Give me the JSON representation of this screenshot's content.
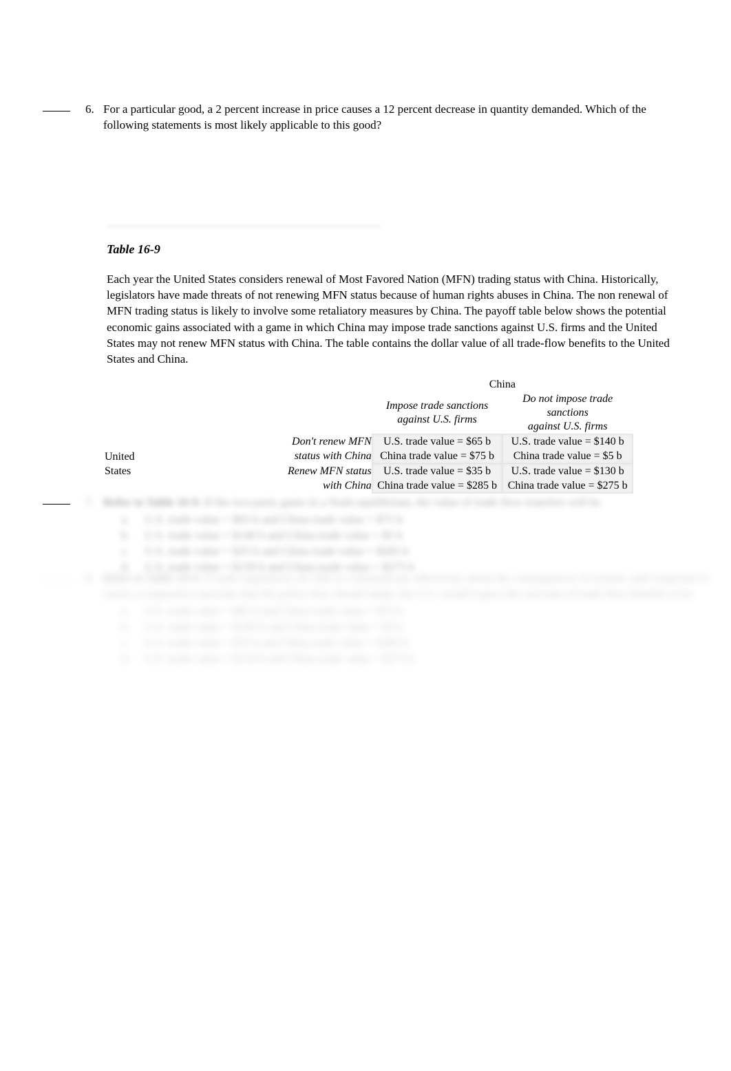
{
  "questions": {
    "q6": {
      "number": "6.",
      "text": "For a particular good, a 2 percent increase in price causes a 12 percent decrease in quantity demanded. Which of the following statements is most likely applicable to this good?"
    },
    "q7": {
      "number": "7.",
      "lead_in": "Refer to Table 16-9.",
      "text": "If the two-party game in a Nash equilibrium, the value of trade flow transfers will be",
      "options": [
        {
          "letter": "a.",
          "text": "U.S. trade value = $65 b and China trade value = $75 b"
        },
        {
          "letter": "b.",
          "text": "U.S. trade value = $140 b and China trade value = $5 b"
        },
        {
          "letter": "c.",
          "text": "U.S. trade value = $35 b and China trade value = $285 b"
        },
        {
          "letter": "d.",
          "text": "U.S. trade value = $130 b and China trade value = $275 b"
        }
      ]
    },
    "q8": {
      "number": "8.",
      "lead_in": "Refer to Table 16-9.",
      "text": "If trade negotiators are able to communicate effectively about the consequences of actions, and cooperate to reach a cooperative outcome that the policy they should adopt, the U.S. would expect the outcome of trade flow benefits to be",
      "options": [
        {
          "letter": "a.",
          "text": "U.S. trade value = $65 b and China trade value = $75 b"
        },
        {
          "letter": "b.",
          "text": "U.S. trade value = $140 b and China trade value = $5 b"
        },
        {
          "letter": "c.",
          "text": "U.S. trade value = $35 b and China trade value = $285 b"
        },
        {
          "letter": "d.",
          "text": "U.S. trade value = $130 b and China trade value = $275 b"
        }
      ]
    }
  },
  "table_16_9": {
    "title": "Table 16-9",
    "description": "Each year the United States considers renewal of Most Favored Nation (MFN) trading status with China. Historically, legislators have made threats of not renewing MFN status because of human rights abuses in China. The non renewal of MFN trading status is likely to involve some retaliatory measures by China. The payoff table below shows the potential economic gains associated with a game in which China may impose trade sanctions against U.S. firms and the United States may not renew MFN status with China. The table contains the dollar value of all trade-flow benefits to the United States and China.",
    "matrix": {
      "column_player": "China",
      "row_player": "United\nStates",
      "column_strategies": [
        "Impose trade sanctions\nagainst U.S. firms",
        "Do not impose trade sanctions\nagainst U.S. firms"
      ],
      "row_strategies": [
        "Don't renew MFN\nstatus with China",
        "Renew MFN status\nwith China"
      ],
      "cells": [
        [
          {
            "us": "U.S. trade value = $65 b",
            "china": "China trade value = $75 b"
          },
          {
            "us": "U.S. trade value = $140 b",
            "china": "China trade value = $5 b"
          }
        ],
        [
          {
            "us": "U.S. trade value = $35 b",
            "china": "China trade value = $285 b"
          },
          {
            "us": "U.S. trade value = $130 b",
            "china": "China trade value = $275 b"
          }
        ]
      ]
    }
  },
  "chart_data": {
    "type": "table",
    "title": "Table 16-9 payoff matrix",
    "xlabel": "China",
    "ylabel": "United States",
    "categories": [
      "Impose trade sanctions against U.S. firms",
      "Do not impose trade sanctions against U.S. firms"
    ],
    "rows": [
      "Don't renew MFN status with China",
      "Renew MFN status with China"
    ],
    "series": [
      {
        "name": "U.S. trade value ($b)",
        "values": [
          [
            65,
            140
          ],
          [
            35,
            130
          ]
        ]
      },
      {
        "name": "China trade value ($b)",
        "values": [
          [
            75,
            5
          ],
          [
            285,
            275
          ]
        ]
      }
    ]
  }
}
